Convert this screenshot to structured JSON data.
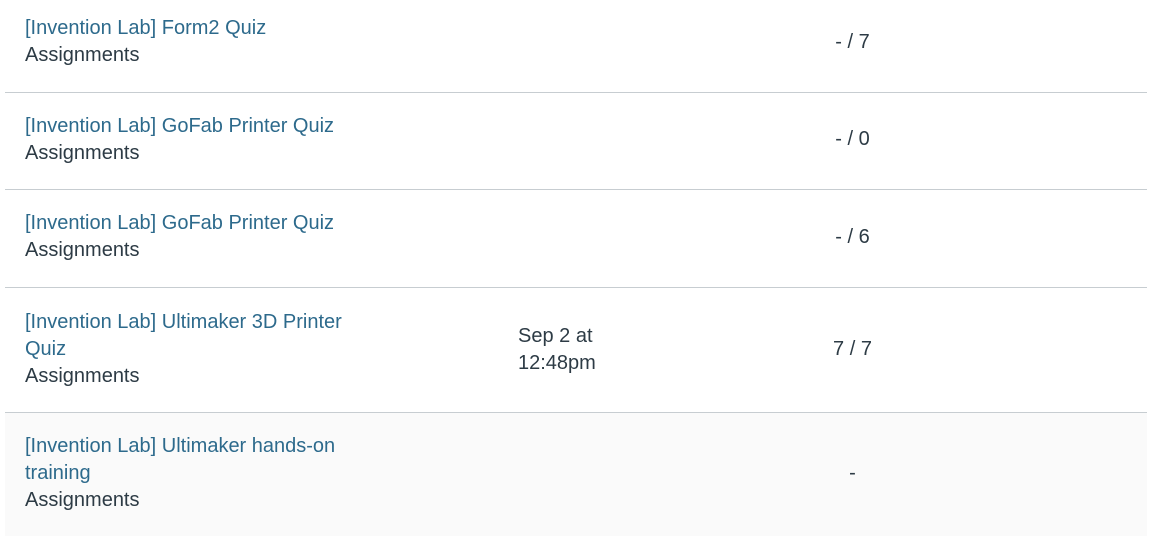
{
  "assignments": [
    {
      "title": "[Invention Lab] Form2 Quiz",
      "context": "Assignments",
      "submitted": "",
      "score": "- / 7"
    },
    {
      "title": "[Invention Lab] GoFab Printer Quiz",
      "context": "Assignments",
      "submitted": "",
      "score": "- / 0"
    },
    {
      "title": "[Invention Lab] GoFab Printer Quiz",
      "context": "Assignments",
      "submitted": "",
      "score": "- / 6"
    },
    {
      "title_line1": "[Invention Lab] Ultimaker 3D Printer",
      "title_line2": "Quiz",
      "context": "Assignments",
      "submitted_line1": "Sep 2 at",
      "submitted_line2": "12:48pm",
      "score": "7 / 7"
    },
    {
      "title_line1": "[Invention Lab] Ultimaker hands-on",
      "title_line2": "training",
      "context": "Assignments",
      "submitted": "",
      "score": "-"
    }
  ]
}
